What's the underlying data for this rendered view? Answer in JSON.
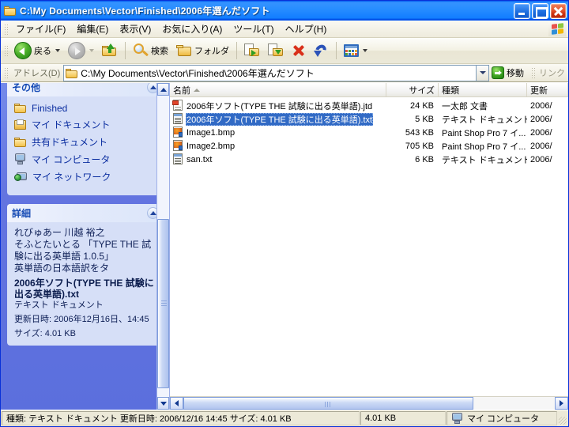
{
  "window": {
    "title": "C:\\My Documents\\Vector\\Finished\\2006年選んだソフト",
    "title_icon": "folder-icon",
    "minimize_label": "",
    "maximize_label": "",
    "close_label": ""
  },
  "menu": {
    "items": [
      {
        "label": "ファイル(F)",
        "name": "menu-file"
      },
      {
        "label": "編集(E)",
        "name": "menu-edit"
      },
      {
        "label": "表示(V)",
        "name": "menu-view"
      },
      {
        "label": "お気に入り(A)",
        "name": "menu-favorites"
      },
      {
        "label": "ツール(T)",
        "name": "menu-tools"
      },
      {
        "label": "ヘルプ(H)",
        "name": "menu-help"
      }
    ]
  },
  "toolbar": {
    "back_label": "戻る",
    "forward_label": "",
    "up_label": "",
    "search_label": "検索",
    "folders_label": "フォルダ",
    "move_to_label": "",
    "copy_to_label": "",
    "delete_label": "",
    "undo_label": "",
    "views_label": ""
  },
  "address": {
    "label": "アドレス(D)",
    "value": "C:\\My Documents\\Vector\\Finished\\2006年選んだソフト",
    "go_label": "移動",
    "links_label": "リンク"
  },
  "sidebar": {
    "other_panel": {
      "title": "その他",
      "items": [
        {
          "label": "Finished",
          "icon": "folder-icon"
        },
        {
          "label": "マイ ドキュメント",
          "icon": "my-documents-icon"
        },
        {
          "label": "共有ドキュメント",
          "icon": "folder-icon"
        },
        {
          "label": "マイ コンピュータ",
          "icon": "my-computer-icon"
        },
        {
          "label": "マイ ネットワーク",
          "icon": "network-icon"
        }
      ]
    },
    "details_panel": {
      "title": "詳細",
      "lines": [
        "れびゅあー 川越 裕之",
        "そふとたいとる 「TYPE THE 試験に出る英単語 1.0.5」",
        "英単語の日本語訳をタ"
      ],
      "file_name": "2006年ソフト(TYPE THE 試験に出る英単語).txt",
      "file_type": "テキスト ドキュメント",
      "modified": "更新日時: 2006年12月16日、14:45",
      "size": "サイズ: 4.01 KB"
    }
  },
  "filelist": {
    "columns": [
      {
        "label": "名前",
        "name": "column-name",
        "sorted": true
      },
      {
        "label": "サイズ",
        "name": "column-size"
      },
      {
        "label": "種類",
        "name": "column-type"
      },
      {
        "label": "更新",
        "name": "column-date"
      }
    ],
    "rows": [
      {
        "name": "2006年ソフト(TYPE THE 試験に出る英単語).jtd",
        "size": "24 KB",
        "type": "一太郎 文書",
        "date": "2006/",
        "icon": "jtd-document-icon",
        "selected": false
      },
      {
        "name": "2006年ソフト(TYPE THE 試験に出る英単語).txt",
        "size": "5 KB",
        "type": "テキスト ドキュメント",
        "date": "2006/",
        "icon": "text-document-icon",
        "selected": true
      },
      {
        "name": "Image1.bmp",
        "size": "543 KB",
        "type": "Paint Shop Pro 7 イ...",
        "date": "2006/",
        "icon": "bitmap-image-icon",
        "selected": false
      },
      {
        "name": "Image2.bmp",
        "size": "705 KB",
        "type": "Paint Shop Pro 7 イ...",
        "date": "2006/",
        "icon": "bitmap-image-icon",
        "selected": false
      },
      {
        "name": "san.txt",
        "size": "6 KB",
        "type": "テキスト ドキュメント",
        "date": "2006/",
        "icon": "text-document-icon",
        "selected": false
      }
    ]
  },
  "statusbar": {
    "details": "種類: テキスト ドキュメント 更新日時: 2006/12/16 14:45 サイズ: 4.01 KB",
    "size": "4.01 KB",
    "location": "マイ コンピュータ",
    "location_icon": "my-computer-icon"
  },
  "colors": {
    "titlebar_blue": "#0058ee",
    "selection_blue": "#316ac5",
    "sidebar_blue": "#6375dd",
    "panel_body": "#d6dff7",
    "chrome_beige": "#ece9d8",
    "link_text": "#0b2ea0"
  }
}
